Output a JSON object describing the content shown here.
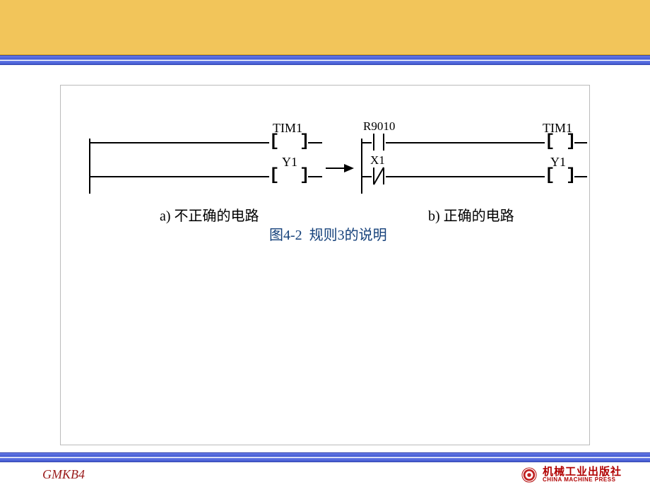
{
  "footer": {
    "left_code": "GMKB4",
    "publisher_zh": "机械工业出版社",
    "publisher_en": "CHINA MACHINE PRESS"
  },
  "diagram": {
    "left": {
      "coils": {
        "tim1": "TIM1",
        "y1": "Y1"
      },
      "caption_prefix": "a)",
      "caption_text": "不正确的电路"
    },
    "right": {
      "contacts": {
        "r9010": "R9010",
        "x1": "X1"
      },
      "coils": {
        "tim1": "TIM1",
        "y1": "Y1"
      },
      "caption_prefix": "b)",
      "caption_text": "正确的电路"
    },
    "figure_label": "图4-2",
    "figure_text": "规则3的说明"
  }
}
